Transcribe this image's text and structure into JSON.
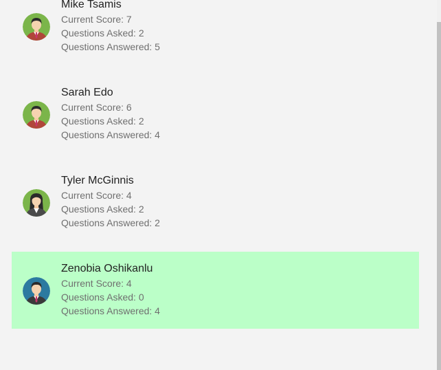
{
  "users": [
    {
      "name": "Mike Tsamis",
      "score_label": "Current Score: 7",
      "asked_label": "Questions Asked: 2",
      "answered_label": "Questions Answered: 5",
      "avatar": "male-avatar-icon",
      "selected": false
    },
    {
      "name": "Sarah Edo",
      "score_label": "Current Score: 6",
      "asked_label": "Questions Asked: 2",
      "answered_label": "Questions Answered: 4",
      "avatar": "male-avatar-icon",
      "selected": false
    },
    {
      "name": "Tyler McGinnis",
      "score_label": "Current Score: 4",
      "asked_label": "Questions Asked: 2",
      "answered_label": "Questions Answered: 2",
      "avatar": "female-avatar-icon",
      "selected": false
    },
    {
      "name": "Zenobia Oshikanlu",
      "score_label": "Current Score: 4",
      "asked_label": "Questions Asked: 0",
      "answered_label": "Questions Answered: 4",
      "avatar": "businessman-avatar-icon",
      "selected": true
    }
  ],
  "colors": {
    "background": "#f3f3f3",
    "selected_row": "#bbffc8",
    "name_text": "#222222",
    "stat_text": "#6f6f6f",
    "avatar_green": "#7bb54a",
    "avatar_blue": "#2c7aa0"
  }
}
